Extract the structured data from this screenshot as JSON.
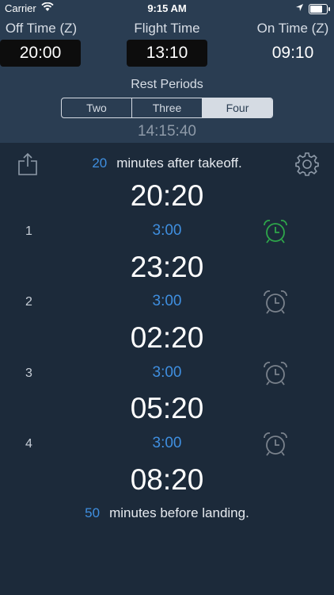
{
  "status_bar": {
    "carrier": "Carrier",
    "time": "9:15 AM",
    "icons": [
      "wifi-icon",
      "location-icon",
      "battery-icon"
    ]
  },
  "header": {
    "off_time": {
      "label": "Off Time (Z)",
      "value": "20:00"
    },
    "flight_time": {
      "label": "Flight Time",
      "value": "13:10"
    },
    "on_time": {
      "label": "On Time (Z)",
      "value": "09:10"
    }
  },
  "rest": {
    "label": "Rest Periods",
    "options": [
      "Two",
      "Three",
      "Four"
    ],
    "selected": "Four",
    "elapsed": "14:15:40"
  },
  "schedule": {
    "after_takeoff_minutes": "20",
    "after_takeoff_text": "minutes after takeoff.",
    "times": [
      "20:20",
      "23:20",
      "02:20",
      "05:20",
      "08:20"
    ],
    "periods": [
      {
        "number": "1",
        "duration": "3:00",
        "alarm_active": true
      },
      {
        "number": "2",
        "duration": "3:00",
        "alarm_active": false
      },
      {
        "number": "3",
        "duration": "3:00",
        "alarm_active": false
      },
      {
        "number": "4",
        "duration": "3:00",
        "alarm_active": false
      }
    ],
    "before_landing_minutes": "50",
    "before_landing_text": "minutes before landing."
  },
  "colors": {
    "background": "#1c2a3a",
    "header": "#2a3d52",
    "accent_blue": "#3f8fe0",
    "alarm_active": "#2ea64a",
    "alarm_inactive": "#7a828c"
  }
}
